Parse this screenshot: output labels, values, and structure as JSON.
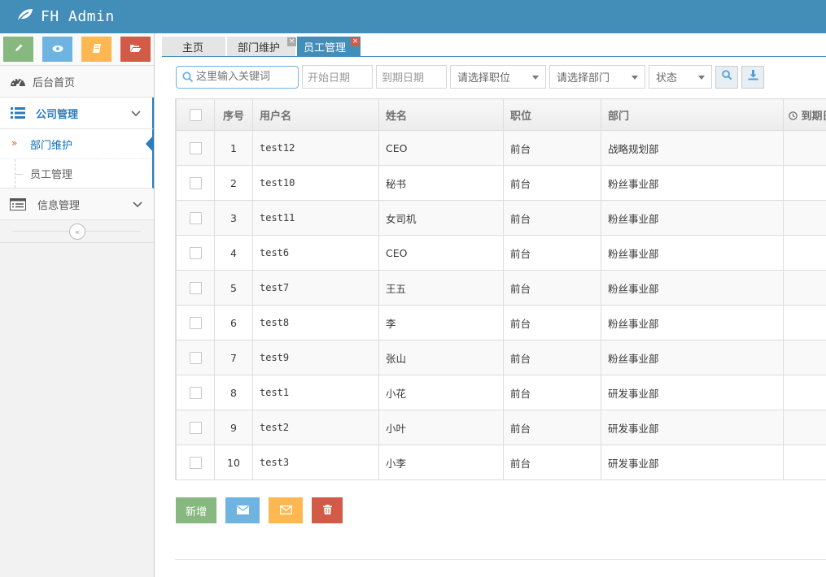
{
  "app": {
    "brand": "FH Admin"
  },
  "sidebar": {
    "shortcuts": [
      "pencil-icon",
      "eye-icon",
      "book-icon",
      "folder-icon"
    ],
    "home_label": "后台首页",
    "company_label": "公司管理",
    "submenu": [
      {
        "label": "部门维护",
        "active": true
      },
      {
        "label": "员工管理",
        "active": false
      }
    ],
    "info_label": "信息管理"
  },
  "tabs": [
    {
      "label": "主页"
    },
    {
      "label": "部门维护"
    },
    {
      "label": "员工管理"
    }
  ],
  "filters": {
    "search_placeholder": "这里输入关键词",
    "start_date": "开始日期",
    "end_date": "到期日期",
    "position_select": "请选择职位",
    "department_select": "请选择部门",
    "status_select": "状态"
  },
  "table": {
    "headers": [
      "序号",
      "用户名",
      "姓名",
      "职位",
      "部门",
      "到期日"
    ],
    "rows": [
      {
        "no": "1",
        "username": "test12",
        "name": "CEO",
        "position": "前台",
        "department": "战略规划部"
      },
      {
        "no": "2",
        "username": "test10",
        "name": "秘书",
        "position": "前台",
        "department": "粉丝事业部"
      },
      {
        "no": "3",
        "username": "test11",
        "name": "女司机",
        "position": "前台",
        "department": "粉丝事业部"
      },
      {
        "no": "4",
        "username": "test6",
        "name": "CEO",
        "position": "前台",
        "department": "粉丝事业部"
      },
      {
        "no": "5",
        "username": "test7",
        "name": "王五",
        "position": "前台",
        "department": "粉丝事业部"
      },
      {
        "no": "6",
        "username": "test8",
        "name": "李",
        "position": "前台",
        "department": "粉丝事业部"
      },
      {
        "no": "7",
        "username": "test9",
        "name": "张山",
        "position": "前台",
        "department": "粉丝事业部"
      },
      {
        "no": "8",
        "username": "test1",
        "name": "小花",
        "position": "前台",
        "department": "研发事业部"
      },
      {
        "no": "9",
        "username": "test2",
        "name": "小叶",
        "position": "前台",
        "department": "研发事业部"
      },
      {
        "no": "10",
        "username": "test3",
        "name": "小李",
        "position": "前台",
        "department": "研发事业部"
      }
    ]
  },
  "actions": {
    "add_label": "新增"
  }
}
